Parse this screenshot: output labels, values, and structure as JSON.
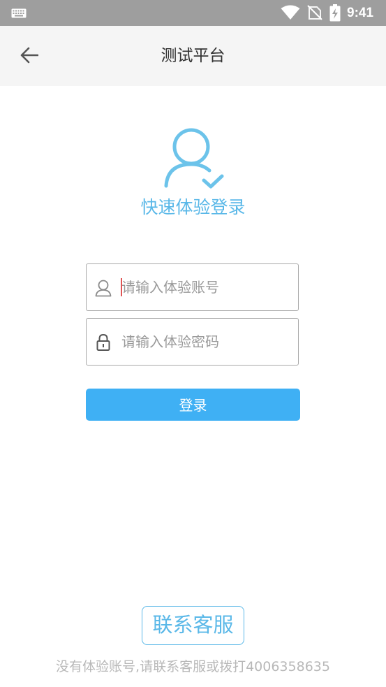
{
  "status_bar": {
    "time": "9:41",
    "icons": [
      "keyboard-icon",
      "wifi-icon",
      "no-sim-icon",
      "battery-charging-icon"
    ]
  },
  "nav": {
    "title": "测试平台",
    "back_icon": "arrow-left-icon"
  },
  "header": {
    "icon": "user-check-icon",
    "title": "快速体验登录"
  },
  "form": {
    "account_placeholder": "请输入体验账号",
    "account_value": "",
    "account_icon": "user-outline-icon",
    "password_placeholder": "请输入体验密码",
    "password_value": "",
    "password_icon": "lock-icon",
    "login_label": "登录"
  },
  "footer": {
    "contact_label": "联系客服",
    "hint": "没有体验账号,请联系客服或拨打4006358635"
  },
  "colors": {
    "accent": "#3fb0f4",
    "brand_light": "#5ab8e8",
    "status_bar": "#9e9e9e"
  }
}
